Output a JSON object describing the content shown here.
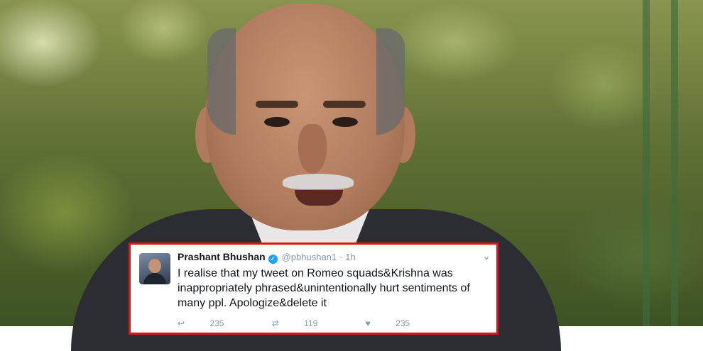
{
  "tweet": {
    "name": "Prashant Bhushan",
    "handle": "@pbhushan1",
    "separator": "·",
    "time": "1h",
    "text": "I realise that my tweet on Romeo squads&Krishna was inappropriately phrased&unintentionally hurt sentiments of many ppl. Apologize&delete it",
    "reply_count": "235",
    "retweet_count": "119",
    "like_count": "235"
  },
  "icons": {
    "verified": "verified-check",
    "menu": "chevron-down",
    "reply": "reply-arrow",
    "retweet": "retweet-arrows",
    "like": "heart"
  },
  "colors": {
    "border": "#e0141b",
    "verified": "#1da1f2",
    "muted": "#8899a6"
  }
}
